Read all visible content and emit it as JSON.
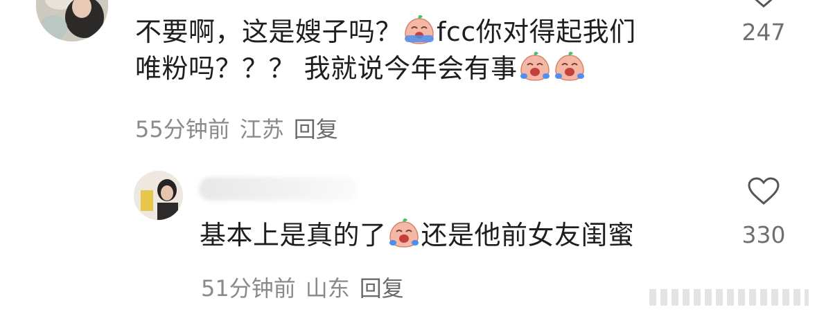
{
  "comment1": {
    "text_line1_a": "不要啊，这是嫂子吗？",
    "text_line1_b": "fcc你对得起我们",
    "text_line2": "唯粉吗？？？ 我就说今年会有事",
    "time": "55分钟前",
    "location": "江苏",
    "reply_label": "回复",
    "like_count": "247"
  },
  "comment2": {
    "text_a": "基本上是真的了",
    "text_b": "还是他前女友闺蜜",
    "time": "51分钟前",
    "location": "山东",
    "reply_label": "回复",
    "like_count": "330"
  },
  "icons": {
    "emoji": "crying-peach-emoji",
    "like": "heart-outline-icon"
  },
  "colors": {
    "text": "#1e1e1e",
    "meta": "#8a8a8a",
    "emoji_peach": "#f6b8a6",
    "emoji_leaf": "#4fbf6a",
    "emoji_tears": "#4c8ff0"
  }
}
